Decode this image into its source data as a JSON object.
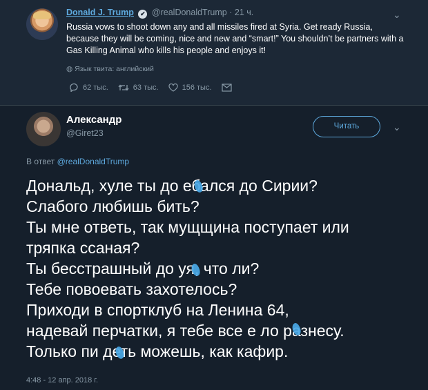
{
  "quoted_tweet": {
    "author_name": "Donald J. Trump",
    "verified_mark": "✔",
    "author_handle": "@realDonaldTrump",
    "time": "· 21 ч.",
    "text": "Russia vows to shoot down any and all missiles fired at Syria. Get ready Russia, because they will be coming, nice and new and “smart!” You shouldn’t be partners with a Gas Killing Animal who kills his people and enjoys it!",
    "language_note": "Язык твита: английский",
    "replies": "62 тыс.",
    "retweets": "63 тыс.",
    "likes": "156 тыс."
  },
  "tweet": {
    "author_name": "Александр",
    "author_handle": "@Giret23",
    "follow_label": "Читать",
    "reply_prefix": "В ответ",
    "reply_handle": "@realDonaldTrump",
    "lines": [
      "Дональд, хуле ты до ебался до Сирии?",
      "Слабого любишь бить?",
      "Ты мне ответь, так мущщина поступает или",
      "тряпка ссаная?",
      "Ты бесстрашный до уя, что ли?",
      "Тебе повоевать захотелось?",
      "Приходи в спортклуб на Ленина 64,",
      "надевай перчатки, я тебе все е ло разнесу.",
      "Только пи деть можешь, как кафир."
    ],
    "timestamp": "4:48 - 12 апр. 2018 г."
  },
  "colors": {
    "background": "#151f2b",
    "quoted_background": "#1c2836",
    "link": "#5ea9dd",
    "muted": "#8899a6",
    "censor_blot": "#4aa8e6"
  },
  "icons": [
    "reply-icon",
    "retweet-icon",
    "like-icon",
    "message-icon",
    "globe-icon",
    "chevron-down-icon",
    "verified-icon"
  ]
}
